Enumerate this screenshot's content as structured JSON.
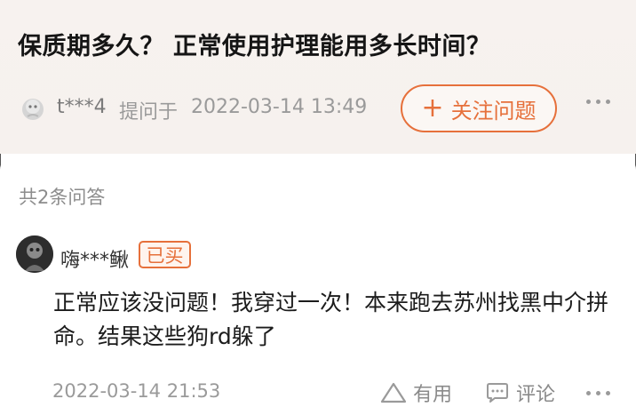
{
  "question": {
    "title": "保质期多久？ 正常使用护理能用多长时间？",
    "asker_name": "t***4",
    "asked_label": "提问于",
    "asked_time": "2022-03-14 13:49",
    "follow_button": {
      "icon": "plus",
      "label": "关注问题"
    },
    "more_icon": "more-dots-icon"
  },
  "answers": {
    "count_label": "共2条问答",
    "items": [
      {
        "name": "嗨***鳅",
        "badge": "已买",
        "text": "正常应该没问题！我穿过一次！本来跑去苏州找黑中介拼命。结果这些狗rd躲了",
        "time": "2022-03-14 21:53",
        "useful_label": "有用",
        "comment_label": "评论"
      }
    ]
  },
  "colors": {
    "accent": "#e6703b",
    "header_bg": "#f7f2ef",
    "muted_text": "#9a9a9a"
  }
}
